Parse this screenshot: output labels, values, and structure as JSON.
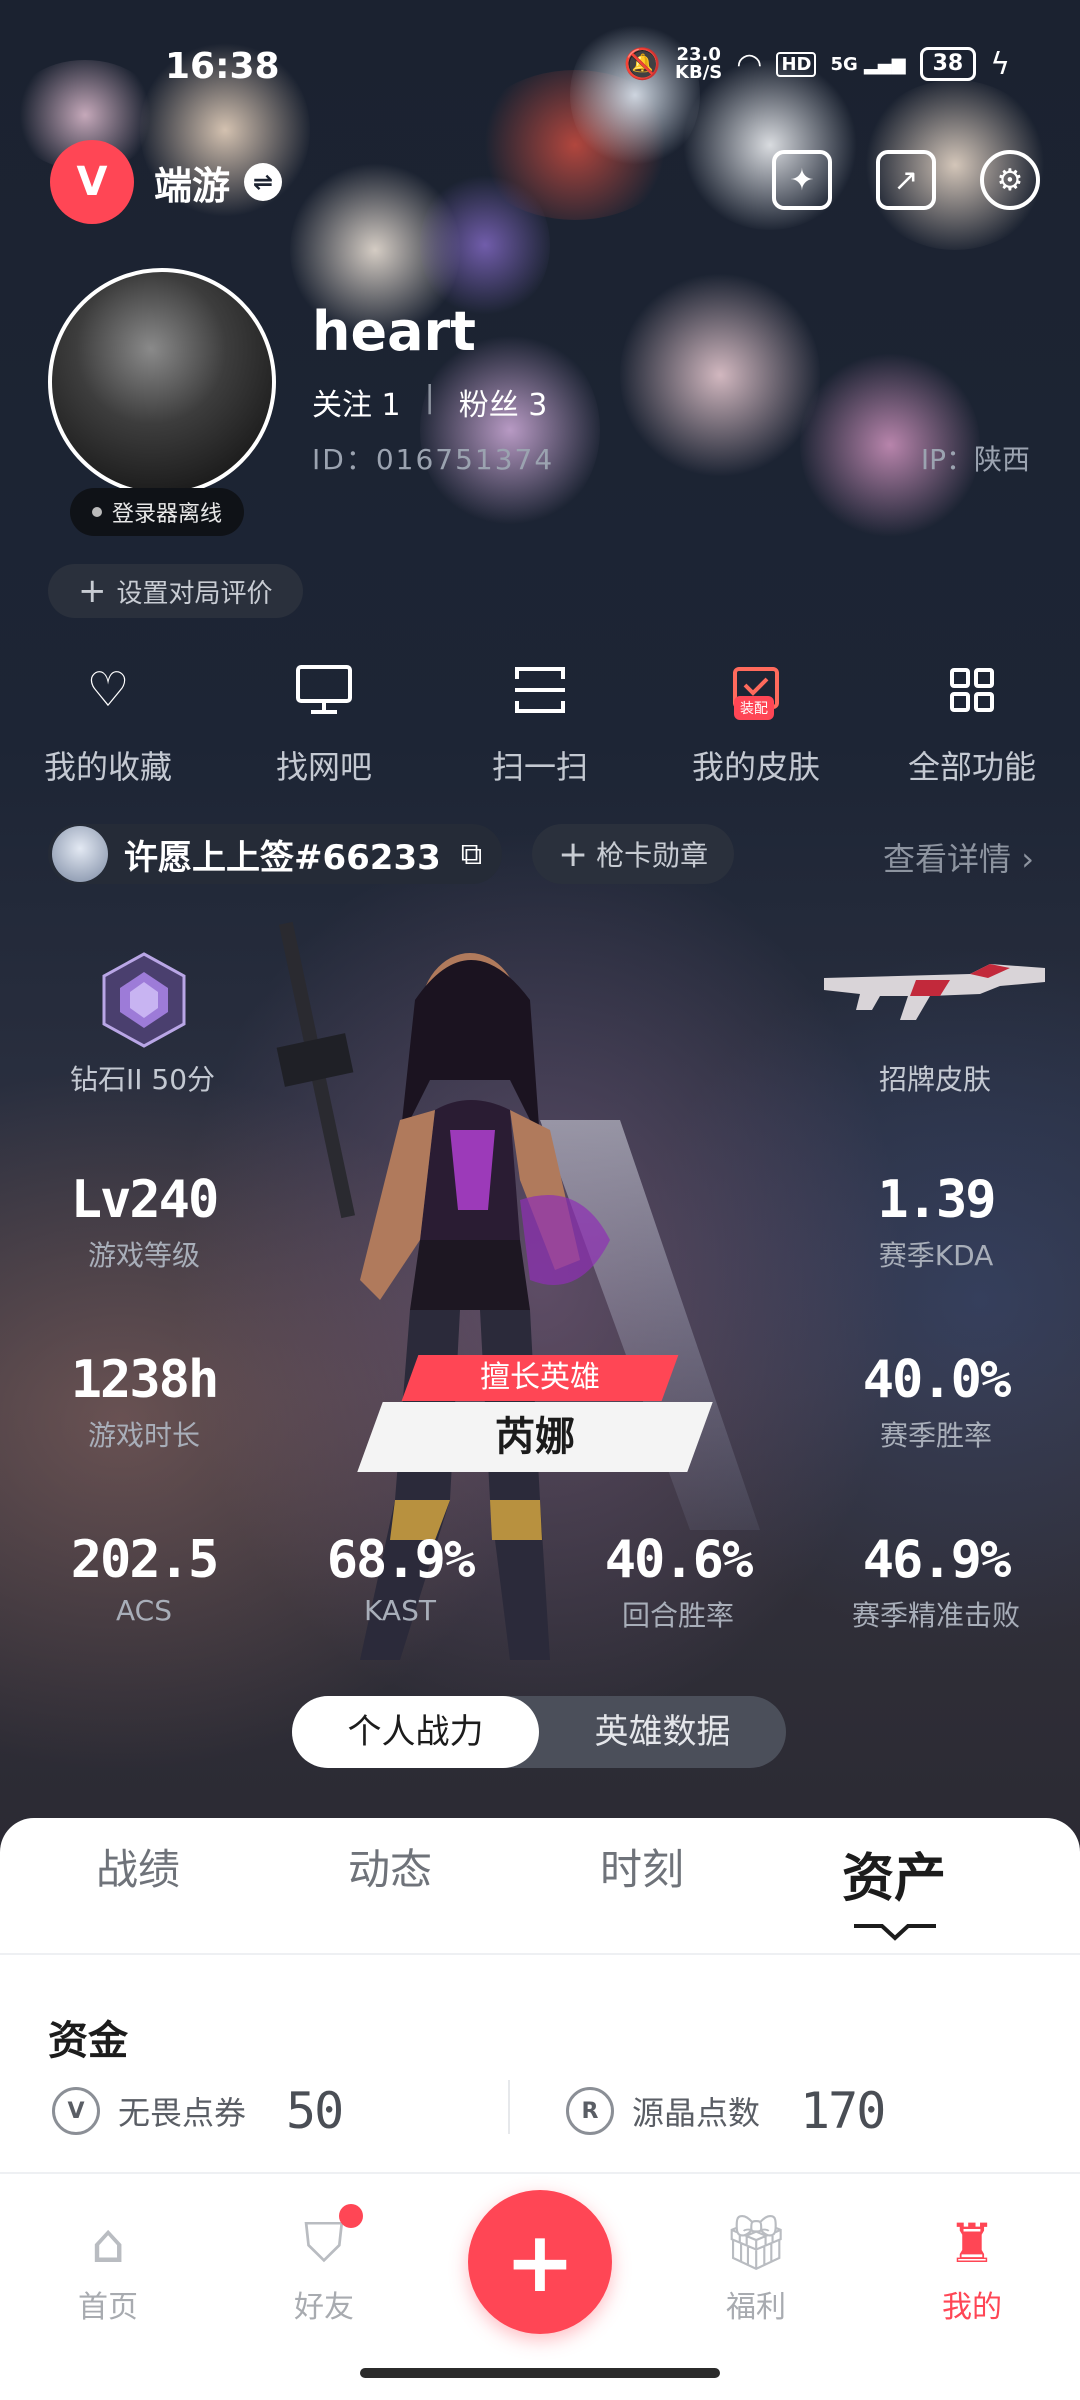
{
  "status_bar": {
    "time": "16:38",
    "net_speed_value": "23.0",
    "net_speed_unit": "KB/S",
    "hd": "HD",
    "signal": "5G",
    "battery": "38"
  },
  "header": {
    "app_logo_letter": "V",
    "app_name": "端游",
    "switch_icon": "⇌"
  },
  "profile": {
    "username": "heart",
    "following_label": "关注",
    "following_count": "1",
    "followers_label": "粉丝",
    "followers_count": "3",
    "id_text": "ID：016751374",
    "ip_text": "IP：陕西",
    "launcher_status": "登录器离线",
    "rate_button": "设置对局评价"
  },
  "shortcuts": [
    {
      "label": "我的收藏",
      "icon": "heart-icon"
    },
    {
      "label": "找网吧",
      "icon": "monitor-icon"
    },
    {
      "label": "扫一扫",
      "icon": "scan-icon"
    },
    {
      "label": "我的皮肤",
      "icon": "skin-icon",
      "badge": "装配"
    },
    {
      "label": "全部功能",
      "icon": "grid-icon"
    }
  ],
  "riot_id": {
    "name": "许愿上上签#66233",
    "medal_button": "枪卡勋章",
    "detail_link": "查看详情"
  },
  "rank": {
    "label": "钻石II 50分"
  },
  "skin": {
    "label": "招牌皮肤"
  },
  "stats": {
    "level": {
      "value": "Lv240",
      "label": "游戏等级"
    },
    "kda": {
      "value": "1.39",
      "label": "赛季KDA"
    },
    "hours": {
      "value": "1238h",
      "label": "游戏时长"
    },
    "win_rate": {
      "value": "40.0%",
      "label": "赛季胜率"
    },
    "acs": {
      "value": "202.5",
      "label": "ACS"
    },
    "kast": {
      "value": "68.9%",
      "label": "KAST"
    },
    "round_win": {
      "value": "40.6%",
      "label": "回合胜率"
    },
    "headshot": {
      "value": "46.9%",
      "label": "赛季精准击败"
    }
  },
  "best_hero": {
    "tag": "擅长英雄",
    "name": "芮娜"
  },
  "toggle": {
    "personal": "个人战力",
    "hero_data": "英雄数据"
  },
  "tabs": [
    "战绩",
    "动态",
    "时刻",
    "资产"
  ],
  "assets": {
    "title": "资金",
    "vp_label": "无畏点券",
    "vp_value": "50",
    "rp_label": "源晶点数",
    "rp_value": "170"
  },
  "bottom_nav": {
    "home": "首页",
    "friends": "好友",
    "welfare": "福利",
    "mine": "我的"
  },
  "colors": {
    "accent": "#ff4655",
    "background": "#131923",
    "sheet": "#ffffff"
  }
}
